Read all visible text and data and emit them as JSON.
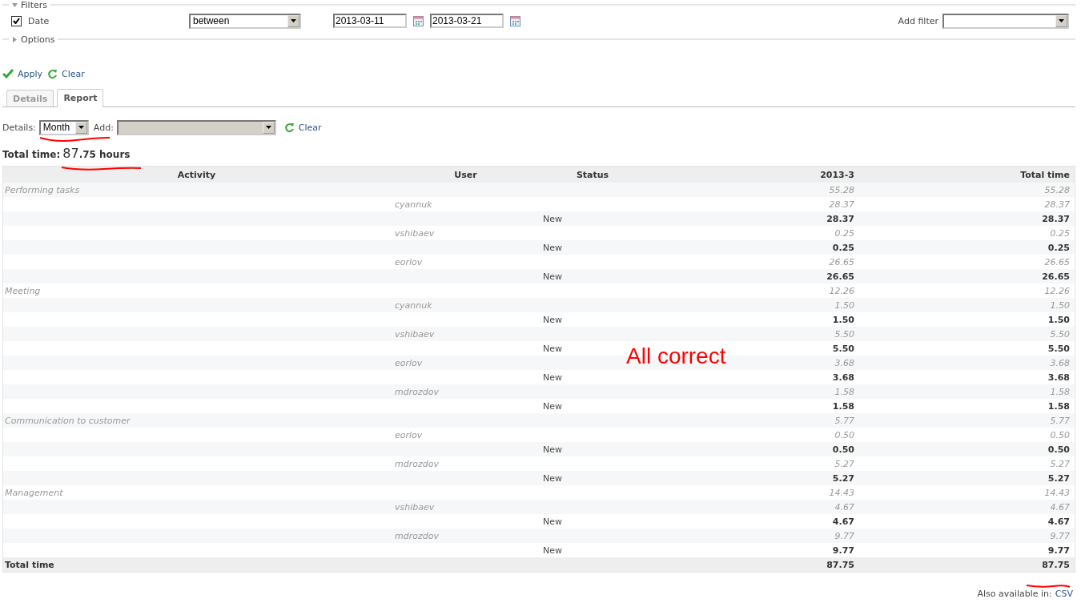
{
  "filters": {
    "legend": "Filters",
    "expanded": true,
    "date_filter": {
      "label": "Date",
      "checked": true,
      "operator": "between",
      "from": "2013-03-11",
      "to": "2013-03-21"
    },
    "add_filter": {
      "label": "Add filter"
    }
  },
  "options": {
    "legend": "Options",
    "expanded": false
  },
  "actions": [
    {
      "label": "Apply",
      "kind": "apply"
    },
    {
      "label": "Clear",
      "kind": "clear"
    }
  ],
  "tabs": [
    {
      "label": "Details",
      "selected": false
    },
    {
      "label": "Report",
      "selected": true
    }
  ],
  "report_controls": {
    "details_label": "Details:",
    "details_value": "Month",
    "add_label": "Add:",
    "add_disabled": true,
    "clear": "Clear"
  },
  "total": {
    "label": "Total time:",
    "value_major": "87",
    "value_minor": ".75 hours"
  },
  "table": {
    "columns": [
      "Activity",
      "User",
      "Status",
      "2013-3",
      "Total time"
    ],
    "activities": [
      {
        "name": "Performing tasks",
        "period": "55.28",
        "total": "55.28",
        "users": [
          {
            "name": "cyannuk",
            "period": "28.37",
            "total": "28.37",
            "statuses": [
              {
                "name": "New",
                "period": "28.37",
                "total": "28.37"
              }
            ]
          },
          {
            "name": "vshibaev",
            "period": "0.25",
            "total": "0.25",
            "statuses": [
              {
                "name": "New",
                "period": "0.25",
                "total": "0.25"
              }
            ]
          },
          {
            "name": "eorlov",
            "period": "26.65",
            "total": "26.65",
            "statuses": [
              {
                "name": "New",
                "period": "26.65",
                "total": "26.65"
              }
            ]
          }
        ]
      },
      {
        "name": "Meeting",
        "period": "12.26",
        "total": "12.26",
        "users": [
          {
            "name": "cyannuk",
            "period": "1.50",
            "total": "1.50",
            "statuses": [
              {
                "name": "New",
                "period": "1.50",
                "total": "1.50"
              }
            ]
          },
          {
            "name": "vshibaev",
            "period": "5.50",
            "total": "5.50",
            "statuses": [
              {
                "name": "New",
                "period": "5.50",
                "total": "5.50"
              }
            ]
          },
          {
            "name": "eorlov",
            "period": "3.68",
            "total": "3.68",
            "statuses": [
              {
                "name": "New",
                "period": "3.68",
                "total": "3.68"
              }
            ]
          },
          {
            "name": "mdrozdov",
            "period": "1.58",
            "total": "1.58",
            "statuses": [
              {
                "name": "New",
                "period": "1.58",
                "total": "1.58"
              }
            ]
          }
        ]
      },
      {
        "name": "Communication to customer",
        "period": "5.77",
        "total": "5.77",
        "users": [
          {
            "name": "eorlov",
            "period": "0.50",
            "total": "0.50",
            "statuses": [
              {
                "name": "New",
                "period": "0.50",
                "total": "0.50"
              }
            ]
          },
          {
            "name": "mdrozdov",
            "period": "5.27",
            "total": "5.27",
            "statuses": [
              {
                "name": "New",
                "period": "5.27",
                "total": "5.27"
              }
            ]
          }
        ]
      },
      {
        "name": "Management",
        "period": "14.43",
        "total": "14.43",
        "users": [
          {
            "name": "vshibaev",
            "period": "4.67",
            "total": "4.67",
            "statuses": [
              {
                "name": "New",
                "period": "4.67",
                "total": "4.67"
              }
            ]
          },
          {
            "name": "mdrozdov",
            "period": "9.77",
            "total": "9.77",
            "statuses": [
              {
                "name": "New",
                "period": "9.77",
                "total": "9.77"
              }
            ]
          }
        ]
      }
    ],
    "footer": {
      "label": "Total time",
      "period": "87.75",
      "total": "87.75"
    }
  },
  "export": {
    "label": "Also available in:",
    "link": "CSV"
  },
  "annotation": {
    "text": "All correct"
  }
}
